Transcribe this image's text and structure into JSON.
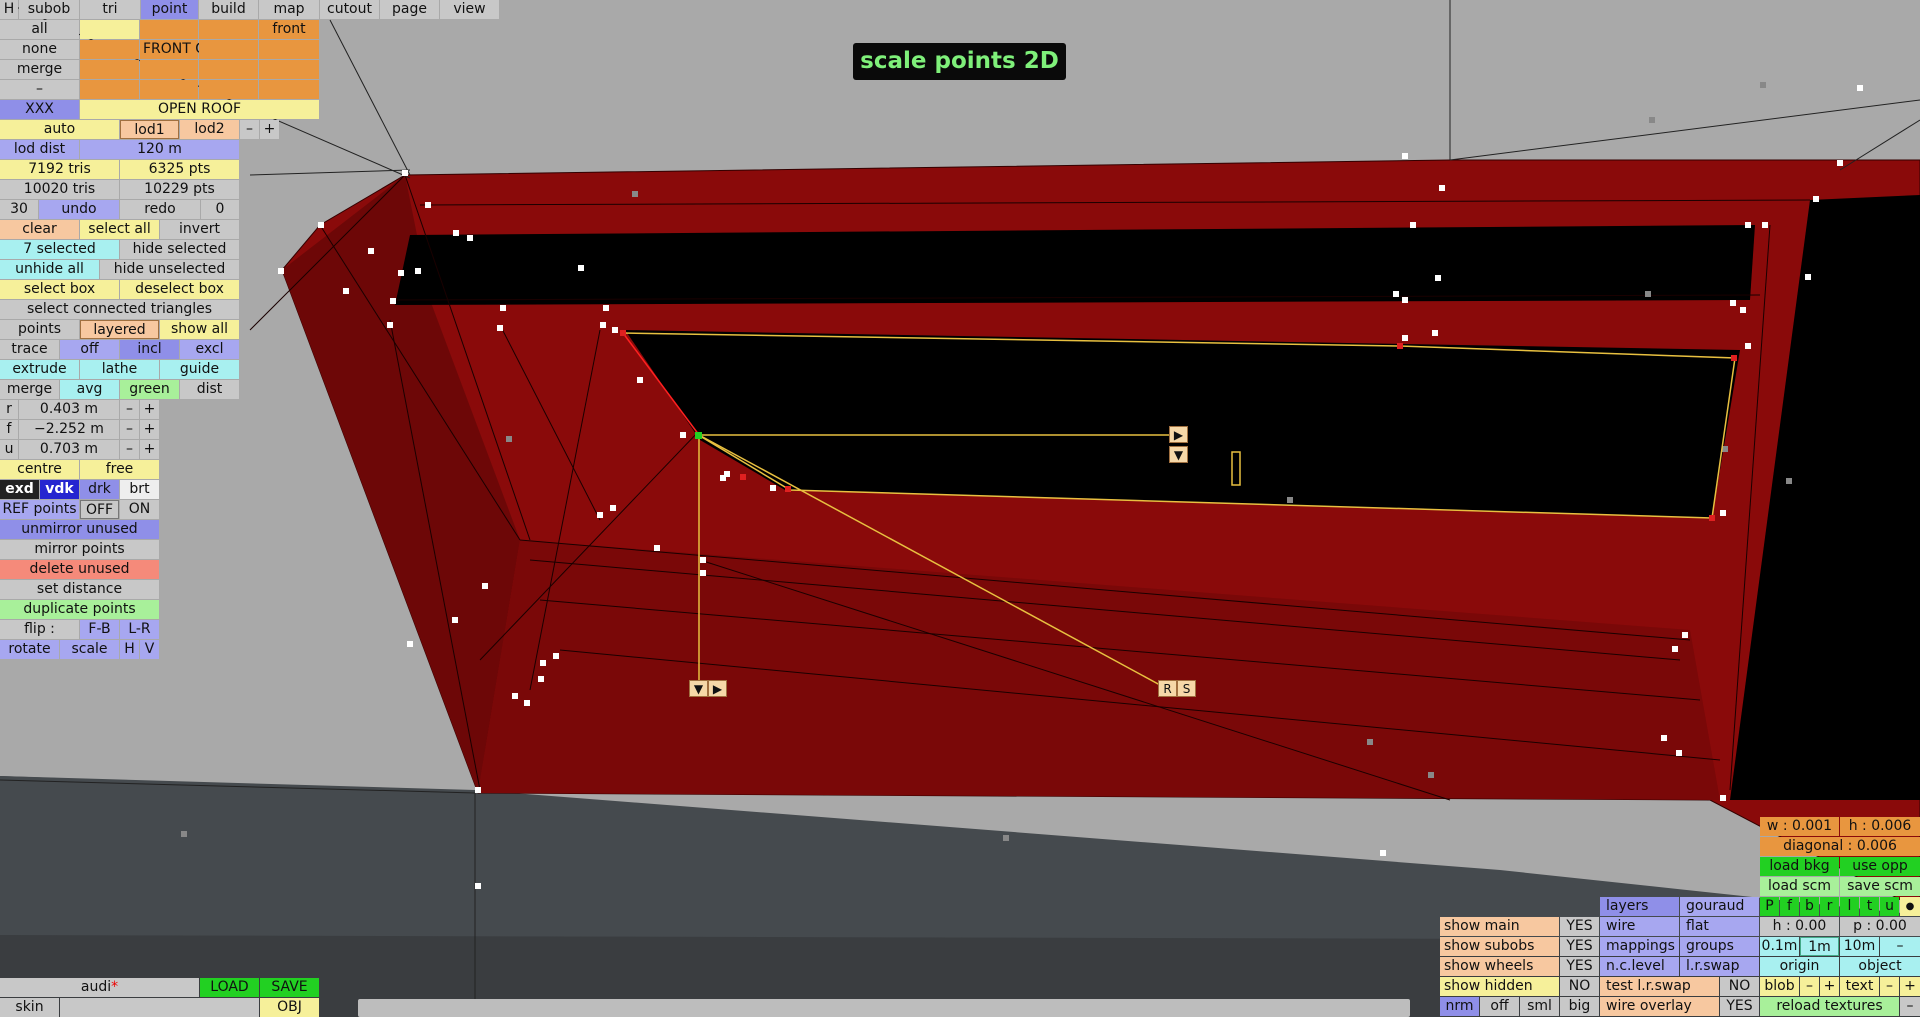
{
  "title": "scale points 2D",
  "menu": {
    "h": "H",
    "tabs": [
      "subob",
      "tri",
      "point",
      "build",
      "map",
      "cutout",
      "page",
      "view"
    ],
    "active": "point"
  },
  "group_grid": {
    "all": "all",
    "none": "none",
    "merge": "merge",
    "dash": "–",
    "front": "front",
    "front_g": "FRONT G",
    "xxx": "XXX",
    "open_roof": "OPEN ROOF"
  },
  "lod": {
    "auto": "auto",
    "lod1": "lod1",
    "lod2": "lod2",
    "minus": "–",
    "plus": "+",
    "dist_label": "lod dist",
    "dist_value": "120 m"
  },
  "stats": {
    "tris1": "7192 tris",
    "pts1": "6325 pts",
    "tris2": "10020 tris",
    "pts2": "10229 pts"
  },
  "history": {
    "count": "30",
    "undo": "undo",
    "redo": "redo",
    "redo_count": "0"
  },
  "selection": {
    "clear": "clear",
    "select_all": "select all",
    "invert": "invert",
    "selected": "7 selected",
    "hide_selected": "hide selected",
    "unhide_all": "unhide all",
    "hide_unselected": "hide unselected",
    "select_box": "select box",
    "deselect_box": "deselect box",
    "select_connected": "select connected triangles"
  },
  "modes": {
    "points": "points",
    "layered": "layered",
    "show_all": "show all",
    "trace": "trace",
    "off": "off",
    "incl": "incl",
    "excl": "excl",
    "extrude": "extrude",
    "lathe": "lathe",
    "guide": "guide",
    "merge": "merge",
    "avg": "avg",
    "green": "green",
    "dist": "dist"
  },
  "coords": [
    {
      "axis": "r",
      "value": "0.403 m"
    },
    {
      "axis": "f",
      "value": "−2.252 m"
    },
    {
      "axis": "u",
      "value": "0.703 m"
    }
  ],
  "coord_btn": {
    "minus": "–",
    "plus": "+"
  },
  "tools": {
    "centre": "centre",
    "free": "free",
    "exd": "exd",
    "vdk": "vdk",
    "drk": "drk",
    "brt": "brt",
    "ref_points": "REF points",
    "ref_off": "OFF",
    "ref_on": "ON",
    "unmirror": "unmirror unused",
    "mirror": "mirror points",
    "delete_unused": "delete unused",
    "set_distance": "set distance",
    "duplicate": "duplicate points",
    "flip": "flip :",
    "fb": "F-B",
    "lr": "L-R",
    "rotate": "rotate",
    "scale": "scale",
    "h": "H",
    "v": "V"
  },
  "file": {
    "name": "audi",
    "modified": "*",
    "load": "LOAD",
    "save": "SAVE",
    "skin": "skin",
    "obj": "OBJ"
  },
  "handles": {
    "right": "▶",
    "down": "▼",
    "r": "R",
    "s": "S"
  },
  "right_panel": {
    "w": "w : 0.001",
    "h": "h : 0.006",
    "diagonal": "diagonal : 0.006",
    "load_bkg": "load bkg",
    "use_opp": "use opp",
    "load_scm": "load scm",
    "save_scm": "save scm",
    "views": [
      "P",
      "f",
      "b",
      "r",
      "l",
      "t",
      "u"
    ],
    "dot": "●",
    "h00": "h : 0.00",
    "p00": "p : 0.00",
    "grid": [
      "0.1m",
      "1m",
      "10m",
      "–"
    ],
    "origin": "origin",
    "object": "object",
    "blob": "blob",
    "text": "text",
    "minus": "–",
    "plus": "+",
    "reload": "reload textures",
    "dash": "–"
  },
  "display": {
    "show_main": "show main",
    "show_subobs": "show subobs",
    "show_wheels": "show wheels",
    "show_hidden": "show hidden",
    "yes": "YES",
    "no": "NO",
    "layers": "layers",
    "gouraud": "gouraud",
    "wire": "wire",
    "flat": "flat",
    "mappings": "mappings",
    "groups": "groups",
    "nclevel": "n.c.level",
    "lrswap": "l.r.swap",
    "test_lrswap": "test l.r.swap",
    "wire_overlay": "wire overlay",
    "nrm": "nrm",
    "off": "off",
    "sml": "sml",
    "big": "big"
  },
  "colors": {
    "body": "#8a0a0a",
    "window": "#000000",
    "selection": "#e8c040",
    "title_text": "#7ff07a"
  }
}
